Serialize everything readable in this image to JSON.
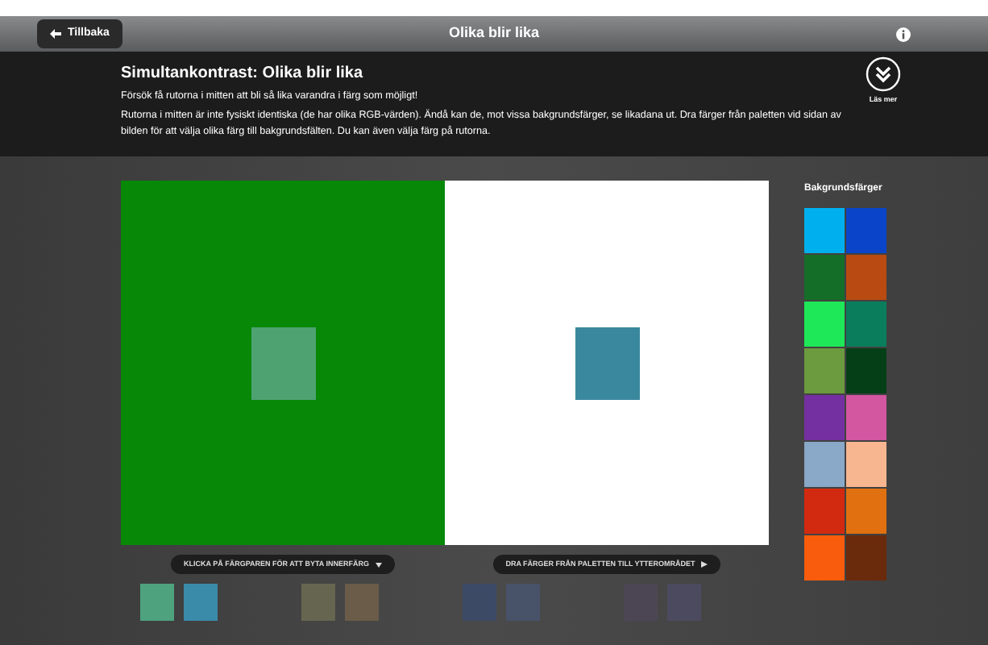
{
  "topbar": {
    "back_button": "Tillbaka",
    "title": "Olika blir lika"
  },
  "info": {
    "heading": "Simultankontrast: Olika blir lika",
    "lines": [
      "Försök få rutorna i mitten att bli så lika varandra i färg som möjligt!",
      "Rutorna i mitten är inte fysiskt identiska (de har olika RGB-värden). Ändå kan de, mot vissa bakgrundsfärger, se likadana ut. Dra färger från paletten vid sidan av bilden för att välja olika färg till bakgrundsfälten. Du kan även välja färg på rutorna."
    ],
    "more_button": "Läs mer"
  },
  "canvas": {
    "fields": [
      {
        "color": "#078807",
        "inner": {
          "color": "#4ea272"
        }
      },
      {
        "color": "#ffffff",
        "inner": {
          "color": "#3a889e"
        }
      }
    ]
  },
  "palette": {
    "title": "Bakgrundsfärger",
    "swatches": [
      {
        "color": "#00b0ee"
      },
      {
        "color": "#0a44c8"
      },
      {
        "color": "#156e28"
      },
      {
        "color": "#b84a12"
      },
      {
        "color": "#1ee858"
      },
      {
        "color": "#0a7e5c"
      },
      {
        "color": "#6c9a3e"
      },
      {
        "color": "#053f18"
      },
      {
        "color": "#7430a0"
      },
      {
        "color": "#d256a0"
      },
      {
        "color": "#8aa8c8"
      },
      {
        "color": "#f8b690"
      },
      {
        "color": "#d22a10"
      },
      {
        "color": "#e07010"
      },
      {
        "color": "#f85c0c"
      },
      {
        "color": "#6a2a0c"
      }
    ]
  },
  "hints": [
    "KLICKA PÅ FÄRGPAREN FÖR ATT BYTA INNERFÄRG",
    "DRA FÄRGER FRÅN PALETTEN TILL YTTEROMRÅDET"
  ],
  "pairs": [
    {
      "swatches": [
        {
          "color": "#4ea27e"
        },
        {
          "color": "#3a8aaa"
        }
      ]
    },
    {
      "swatches": [
        {
          "color": "#666650"
        },
        {
          "color": "#6a5c48"
        }
      ]
    },
    {
      "swatches": [
        {
          "color": "#3c4a66"
        },
        {
          "color": "#485268"
        }
      ]
    },
    {
      "swatches": [
        {
          "color": "#4c4654"
        },
        {
          "color": "#4c4a5e"
        }
      ]
    }
  ]
}
